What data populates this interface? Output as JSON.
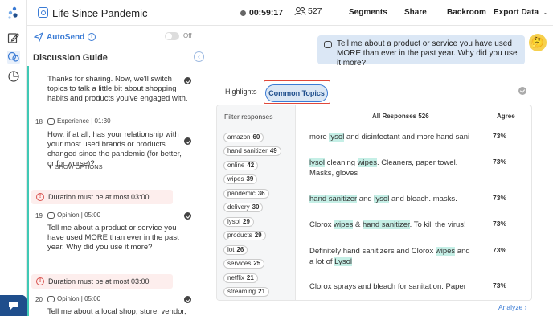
{
  "app": {
    "title": "Life Since Pandemic",
    "timer": "00:59:17",
    "participants": "527",
    "nav": [
      "Segments",
      "Share",
      "Backroom",
      "Export Data"
    ]
  },
  "guide": {
    "autosend_label": "AutoSend",
    "toggle_label": "Off",
    "title": "Discussion Guide",
    "items": [
      {
        "text": "Thanks for sharing. Now, we'll switch topics to talk a little bit about shopping habits and products you've engaged with."
      },
      {
        "num": "18",
        "meta": "Experience | 01:30",
        "text": "How, if at all, has your relationship with your most used brands or products changed since the pandemic (for better, or for worse)?",
        "options": "SHOW OPTIONS"
      },
      {
        "warning": "Duration must be at most 03:00"
      },
      {
        "num": "19",
        "meta": "Opinion | 05:00",
        "text": "Tell me about a product or service you have used MORE than ever in the past year. Why did you use it more?"
      },
      {
        "warning": "Duration must be at most 03:00"
      },
      {
        "num": "20",
        "meta": "Opinion | 05:00",
        "text": "Tell me about a local shop, store, vendor, or"
      }
    ]
  },
  "main": {
    "question": "Tell me about a product or service you have used MORE than ever in the past year. Why did you use it more?",
    "avatar": "🤔",
    "tabs": [
      "Highlights",
      "Common Topics"
    ],
    "filter_head": "Filter responses",
    "responses_head": "All Responses 526",
    "agree_head": "Agree",
    "filters": [
      {
        "label": "amazon",
        "count": "60"
      },
      {
        "label": "hand sanitizer",
        "count": "49"
      },
      {
        "label": "online",
        "count": "42"
      },
      {
        "label": "wipes",
        "count": "39"
      },
      {
        "label": "pandemic",
        "count": "36"
      },
      {
        "label": "delivery",
        "count": "30"
      },
      {
        "label": "lysol",
        "count": "29"
      },
      {
        "label": "products",
        "count": "29"
      },
      {
        "label": "lot",
        "count": "26"
      },
      {
        "label": "services",
        "count": "25"
      },
      {
        "label": "netflix",
        "count": "21"
      },
      {
        "label": "streaming",
        "count": "21"
      }
    ],
    "rows": [
      {
        "pct": "73%"
      },
      {
        "pct": "73%"
      },
      {
        "pct": "73%"
      },
      {
        "pct": "73%"
      },
      {
        "pct": "73%"
      },
      {
        "pct": "73%"
      }
    ],
    "row_texts": {
      "r0_a": "more ",
      "r0_b": "lysol",
      "r0_c": " and disinfectant and more hand sani",
      "r1_a": "lysol",
      "r1_b": " cleaning ",
      "r1_c": "wipes",
      "r1_d": ". Cleaners, paper towel. Masks, gloves",
      "r2_a": "hand sanitizer",
      "r2_b": " and ",
      "r2_c": "lysol",
      "r2_d": " and bleach. masks.",
      "r3_a": "Clorox ",
      "r3_b": "wipes",
      "r3_c": " & ",
      "r3_d": "hand sanitizer",
      "r3_e": ". To kill the virus!",
      "r4_a": "Definitely hand sanitizers and Clorox ",
      "r4_b": "wipes",
      "r4_c": " and a lot of ",
      "r4_d": "Lysol",
      "r5_a": "Clorox sprays and bleach for sanitation. Paper"
    },
    "analyze": "Analyze"
  }
}
